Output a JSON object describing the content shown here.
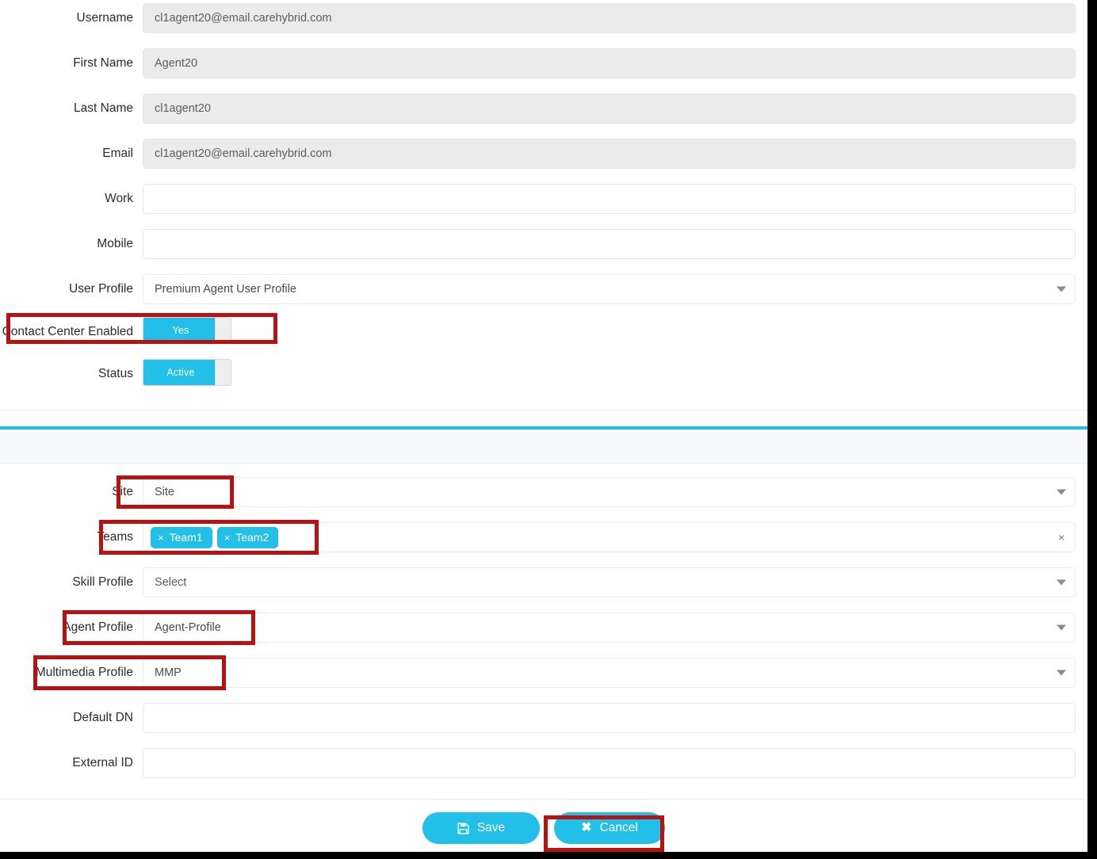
{
  "form": {
    "fields": [
      {
        "label": "Username",
        "value": "cl1agent20@email.carehybrid.com",
        "state": "disabled",
        "control": "text"
      },
      {
        "label": "First Name",
        "value": "Agent20",
        "state": "disabled",
        "control": "text"
      },
      {
        "label": "Last Name",
        "value": "cl1agent20",
        "state": "disabled",
        "control": "text"
      },
      {
        "label": "Email",
        "value": "cl1agent20@email.carehybrid.com",
        "state": "disabled",
        "control": "text"
      },
      {
        "label": "Work",
        "value": "",
        "state": "enabled",
        "control": "text"
      },
      {
        "label": "Mobile",
        "value": "",
        "state": "enabled",
        "control": "text"
      },
      {
        "label": "User Profile",
        "value": "Premium Agent User Profile",
        "state": "enabled",
        "control": "select"
      }
    ],
    "toggles": [
      {
        "label": "Contact Center Enabled",
        "value": "Yes",
        "on": true
      },
      {
        "label": "Status",
        "value": "Active",
        "on": true
      }
    ]
  },
  "contact_center": {
    "fields": [
      {
        "label": "Site",
        "value": "Site",
        "control": "select"
      },
      {
        "label": "Teams",
        "chips": [
          "Team1",
          "Team2"
        ],
        "control": "multiselect",
        "clear": "×"
      },
      {
        "label": "Skill Profile",
        "value": "Select",
        "control": "select",
        "placeholder": true
      },
      {
        "label": "Agent Profile",
        "value": "Agent-Profile",
        "control": "select"
      },
      {
        "label": "Multimedia Profile",
        "value": "MMP",
        "control": "select"
      },
      {
        "label": "Default DN",
        "value": "",
        "control": "text"
      },
      {
        "label": "External ID",
        "value": "",
        "control": "text"
      }
    ]
  },
  "footer": {
    "save_label": "Save",
    "cancel_label": "Cancel",
    "cancel_glyph": "✖"
  },
  "chip_close_glyph": "×",
  "colors": {
    "accent_cyan": "#22c0e8",
    "annotation_red": "#b61212",
    "disabled_field": "#ebebeb",
    "section_band": "#f7f9fb"
  }
}
